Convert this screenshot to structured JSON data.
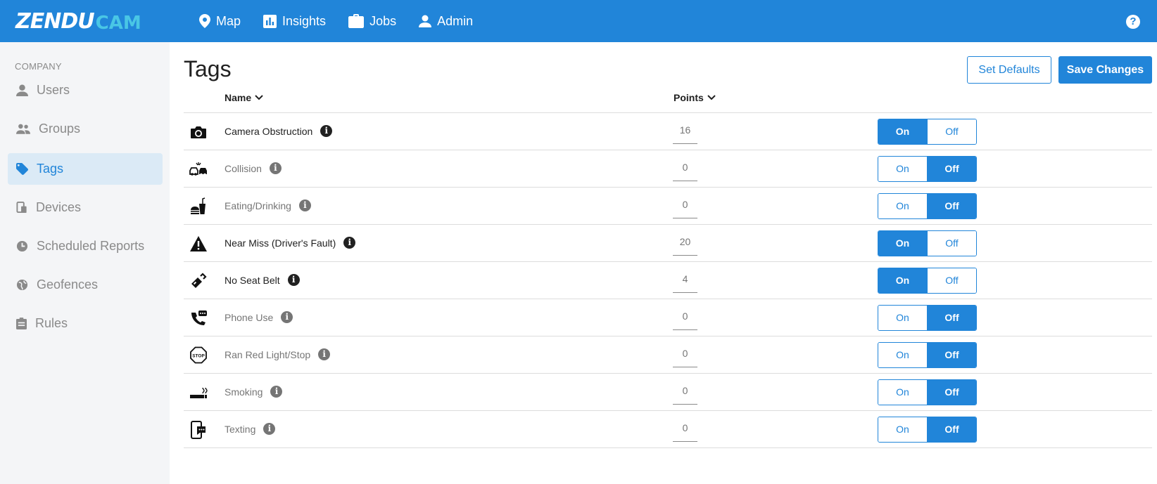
{
  "app": {
    "logo_main": "ZENDU",
    "logo_accent": "CAM"
  },
  "nav": [
    {
      "label": "Map",
      "icon": "map-pin-icon"
    },
    {
      "label": "Insights",
      "icon": "bar-chart-icon"
    },
    {
      "label": "Jobs",
      "icon": "briefcase-icon"
    },
    {
      "label": "Admin",
      "icon": "person-icon"
    }
  ],
  "help_label": "?",
  "sidebar": {
    "section": "COMPANY",
    "items": [
      {
        "label": "Users",
        "icon": "person-icon"
      },
      {
        "label": "Groups",
        "icon": "group-icon"
      },
      {
        "label": "Tags",
        "icon": "tag-icon",
        "active": true
      },
      {
        "label": "Devices",
        "icon": "devices-icon"
      },
      {
        "label": "Scheduled Reports",
        "icon": "clock-icon"
      },
      {
        "label": "Geofences",
        "icon": "globe-icon"
      },
      {
        "label": "Rules",
        "icon": "clipboard-icon"
      }
    ]
  },
  "page": {
    "title": "Tags",
    "set_defaults": "Set Defaults",
    "save_changes": "Save Changes"
  },
  "table": {
    "col_name": "Name",
    "col_points": "Points",
    "toggle_on": "On",
    "toggle_off": "Off",
    "rows": [
      {
        "name": "Camera Obstruction",
        "points": "16",
        "enabled": true,
        "icon": "camera-icon"
      },
      {
        "name": "Collision",
        "points": "0",
        "enabled": false,
        "icon": "collision-icon"
      },
      {
        "name": "Eating/Drinking",
        "points": "0",
        "enabled": false,
        "icon": "food-drink-icon"
      },
      {
        "name": "Near Miss (Driver's Fault)",
        "points": "20",
        "enabled": true,
        "icon": "warning-icon"
      },
      {
        "name": "No Seat Belt",
        "points": "4",
        "enabled": true,
        "icon": "seat-belt-icon"
      },
      {
        "name": "Phone Use",
        "points": "0",
        "enabled": false,
        "icon": "phone-icon"
      },
      {
        "name": "Ran Red Light/Stop",
        "points": "0",
        "enabled": false,
        "icon": "stop-sign-icon"
      },
      {
        "name": "Smoking",
        "points": "0",
        "enabled": false,
        "icon": "cigarette-icon"
      },
      {
        "name": "Texting",
        "points": "0",
        "enabled": false,
        "icon": "texting-icon"
      }
    ]
  },
  "colors": {
    "primary": "#2185d9",
    "sidebar_bg": "#f4f5f7",
    "active_bg": "#dbeaf6",
    "logo_accent": "#49c6e5"
  }
}
